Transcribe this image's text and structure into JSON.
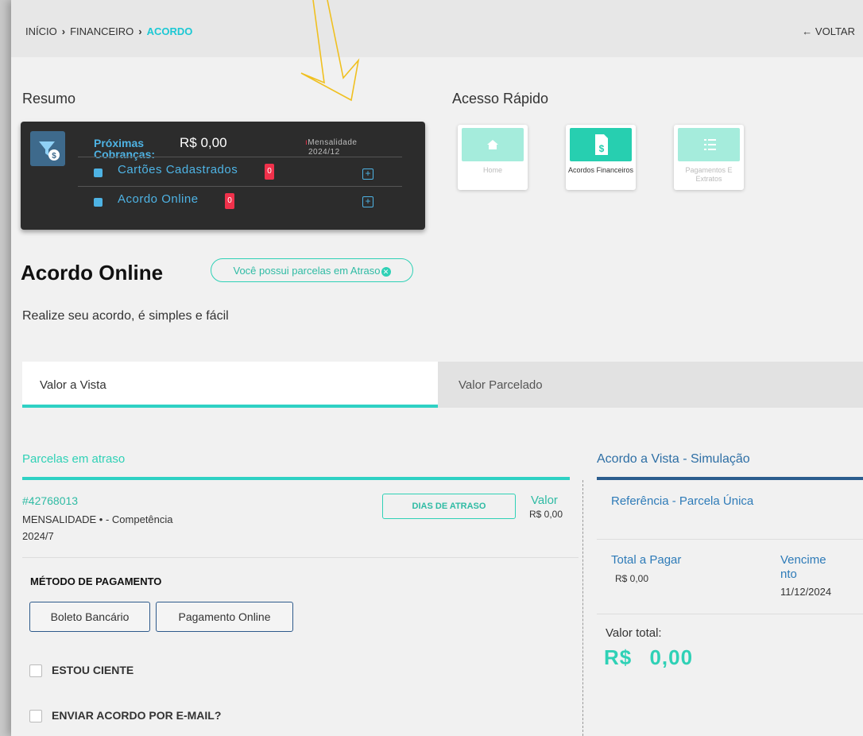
{
  "breadcrumb": {
    "items": [
      "INÍCIO",
      "FINANCEIRO",
      "ACORDO"
    ],
    "back_label": "VOLTAR"
  },
  "resumo": {
    "title": "Resumo",
    "proximas_label": "Próximas Cobranças:",
    "proximas_value": "R$ 0,00",
    "mensalidade_label": "Mensalidade",
    "mensalidade_period": "2024/12",
    "links": [
      {
        "label": "Cartões Cadastrados",
        "count": "0"
      },
      {
        "label": "Acordo Online",
        "count": "0"
      }
    ]
  },
  "acesso_rapido": {
    "title": "Acesso Rápido",
    "items": [
      {
        "label": "Home",
        "icon": "home-icon"
      },
      {
        "label": "Acordos Financeiros",
        "icon": "document-dollar-icon"
      },
      {
        "label": "Pagamentos E Extratos",
        "icon": "checklist-icon"
      }
    ]
  },
  "page": {
    "title": "Acordo Online",
    "alert": "Você possui parcelas em Atraso",
    "subtitle": "Realize seu acordo, é simples e fácil"
  },
  "tabs": [
    {
      "label": "Valor a Vista",
      "active": true
    },
    {
      "label": "Valor Parcelado",
      "active": false
    }
  ],
  "parcelas": {
    "title": "Parcelas em atraso",
    "item": {
      "id": "#42768013",
      "desc_line1": "MENSALIDADE  • - Competência",
      "desc_line2": "2024/7",
      "dias_label": "DIAS DE ATRASO",
      "valor_label": "Valor",
      "valor_value": "R$ 0,00"
    }
  },
  "metodo": {
    "title": "MÉTODO DE PAGAMENTO",
    "options": [
      "Boleto Bancário",
      "Pagamento Online"
    ],
    "estou_ciente": "ESTOU CIENTE",
    "enviar_email": "ENVIAR ACORDO POR E-MAIL?"
  },
  "simulacao": {
    "title": "Acordo a Vista - Simulação",
    "referencia": "Referência - Parcela Única",
    "total_label": "Total a Pagar",
    "total_value": "R$ 0,00",
    "venc_label": "Vencimento",
    "venc_value": "11/12/2024",
    "valor_total_label": "Valor total:",
    "valor_total_value": "R$ 0,00"
  },
  "colors": {
    "teal": "#2fd1b6",
    "navy": "#2b5d8e",
    "link_blue": "#2e7bb8",
    "badge_red": "#f0314b",
    "dark_card": "#2c2c2c"
  }
}
